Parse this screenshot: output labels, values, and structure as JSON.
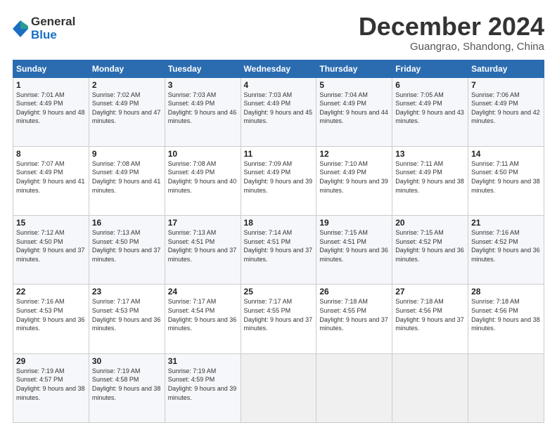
{
  "logo": {
    "general": "General",
    "blue": "Blue"
  },
  "title": "December 2024",
  "location": "Guangrao, Shandong, China",
  "headers": [
    "Sunday",
    "Monday",
    "Tuesday",
    "Wednesday",
    "Thursday",
    "Friday",
    "Saturday"
  ],
  "weeks": [
    [
      {
        "day": "1",
        "sunrise": "Sunrise: 7:01 AM",
        "sunset": "Sunset: 4:49 PM",
        "daylight": "Daylight: 9 hours and 48 minutes."
      },
      {
        "day": "2",
        "sunrise": "Sunrise: 7:02 AM",
        "sunset": "Sunset: 4:49 PM",
        "daylight": "Daylight: 9 hours and 47 minutes."
      },
      {
        "day": "3",
        "sunrise": "Sunrise: 7:03 AM",
        "sunset": "Sunset: 4:49 PM",
        "daylight": "Daylight: 9 hours and 46 minutes."
      },
      {
        "day": "4",
        "sunrise": "Sunrise: 7:03 AM",
        "sunset": "Sunset: 4:49 PM",
        "daylight": "Daylight: 9 hours and 45 minutes."
      },
      {
        "day": "5",
        "sunrise": "Sunrise: 7:04 AM",
        "sunset": "Sunset: 4:49 PM",
        "daylight": "Daylight: 9 hours and 44 minutes."
      },
      {
        "day": "6",
        "sunrise": "Sunrise: 7:05 AM",
        "sunset": "Sunset: 4:49 PM",
        "daylight": "Daylight: 9 hours and 43 minutes."
      },
      {
        "day": "7",
        "sunrise": "Sunrise: 7:06 AM",
        "sunset": "Sunset: 4:49 PM",
        "daylight": "Daylight: 9 hours and 42 minutes."
      }
    ],
    [
      {
        "day": "8",
        "sunrise": "Sunrise: 7:07 AM",
        "sunset": "Sunset: 4:49 PM",
        "daylight": "Daylight: 9 hours and 41 minutes."
      },
      {
        "day": "9",
        "sunrise": "Sunrise: 7:08 AM",
        "sunset": "Sunset: 4:49 PM",
        "daylight": "Daylight: 9 hours and 41 minutes."
      },
      {
        "day": "10",
        "sunrise": "Sunrise: 7:08 AM",
        "sunset": "Sunset: 4:49 PM",
        "daylight": "Daylight: 9 hours and 40 minutes."
      },
      {
        "day": "11",
        "sunrise": "Sunrise: 7:09 AM",
        "sunset": "Sunset: 4:49 PM",
        "daylight": "Daylight: 9 hours and 39 minutes."
      },
      {
        "day": "12",
        "sunrise": "Sunrise: 7:10 AM",
        "sunset": "Sunset: 4:49 PM",
        "daylight": "Daylight: 9 hours and 39 minutes."
      },
      {
        "day": "13",
        "sunrise": "Sunrise: 7:11 AM",
        "sunset": "Sunset: 4:49 PM",
        "daylight": "Daylight: 9 hours and 38 minutes."
      },
      {
        "day": "14",
        "sunrise": "Sunrise: 7:11 AM",
        "sunset": "Sunset: 4:50 PM",
        "daylight": "Daylight: 9 hours and 38 minutes."
      }
    ],
    [
      {
        "day": "15",
        "sunrise": "Sunrise: 7:12 AM",
        "sunset": "Sunset: 4:50 PM",
        "daylight": "Daylight: 9 hours and 37 minutes."
      },
      {
        "day": "16",
        "sunrise": "Sunrise: 7:13 AM",
        "sunset": "Sunset: 4:50 PM",
        "daylight": "Daylight: 9 hours and 37 minutes."
      },
      {
        "day": "17",
        "sunrise": "Sunrise: 7:13 AM",
        "sunset": "Sunset: 4:51 PM",
        "daylight": "Daylight: 9 hours and 37 minutes."
      },
      {
        "day": "18",
        "sunrise": "Sunrise: 7:14 AM",
        "sunset": "Sunset: 4:51 PM",
        "daylight": "Daylight: 9 hours and 37 minutes."
      },
      {
        "day": "19",
        "sunrise": "Sunrise: 7:15 AM",
        "sunset": "Sunset: 4:51 PM",
        "daylight": "Daylight: 9 hours and 36 minutes."
      },
      {
        "day": "20",
        "sunrise": "Sunrise: 7:15 AM",
        "sunset": "Sunset: 4:52 PM",
        "daylight": "Daylight: 9 hours and 36 minutes."
      },
      {
        "day": "21",
        "sunrise": "Sunrise: 7:16 AM",
        "sunset": "Sunset: 4:52 PM",
        "daylight": "Daylight: 9 hours and 36 minutes."
      }
    ],
    [
      {
        "day": "22",
        "sunrise": "Sunrise: 7:16 AM",
        "sunset": "Sunset: 4:53 PM",
        "daylight": "Daylight: 9 hours and 36 minutes."
      },
      {
        "day": "23",
        "sunrise": "Sunrise: 7:17 AM",
        "sunset": "Sunset: 4:53 PM",
        "daylight": "Daylight: 9 hours and 36 minutes."
      },
      {
        "day": "24",
        "sunrise": "Sunrise: 7:17 AM",
        "sunset": "Sunset: 4:54 PM",
        "daylight": "Daylight: 9 hours and 36 minutes."
      },
      {
        "day": "25",
        "sunrise": "Sunrise: 7:17 AM",
        "sunset": "Sunset: 4:55 PM",
        "daylight": "Daylight: 9 hours and 37 minutes."
      },
      {
        "day": "26",
        "sunrise": "Sunrise: 7:18 AM",
        "sunset": "Sunset: 4:55 PM",
        "daylight": "Daylight: 9 hours and 37 minutes."
      },
      {
        "day": "27",
        "sunrise": "Sunrise: 7:18 AM",
        "sunset": "Sunset: 4:56 PM",
        "daylight": "Daylight: 9 hours and 37 minutes."
      },
      {
        "day": "28",
        "sunrise": "Sunrise: 7:18 AM",
        "sunset": "Sunset: 4:56 PM",
        "daylight": "Daylight: 9 hours and 38 minutes."
      }
    ],
    [
      {
        "day": "29",
        "sunrise": "Sunrise: 7:19 AM",
        "sunset": "Sunset: 4:57 PM",
        "daylight": "Daylight: 9 hours and 38 minutes."
      },
      {
        "day": "30",
        "sunrise": "Sunrise: 7:19 AM",
        "sunset": "Sunset: 4:58 PM",
        "daylight": "Daylight: 9 hours and 38 minutes."
      },
      {
        "day": "31",
        "sunrise": "Sunrise: 7:19 AM",
        "sunset": "Sunset: 4:59 PM",
        "daylight": "Daylight: 9 hours and 39 minutes."
      },
      null,
      null,
      null,
      null
    ]
  ]
}
